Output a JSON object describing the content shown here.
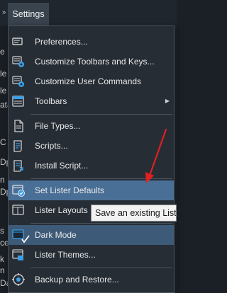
{
  "menubar": {
    "chevron": "»",
    "settings_label": "Settings"
  },
  "background_letters": [
    "e",
    "le",
    "le",
    "ata",
    "C",
    "Dp",
    "n",
    "Dp",
    "s",
    "cen",
    "k",
    "n",
    "Da"
  ],
  "menu": {
    "items": [
      {
        "label": "Preferences...",
        "icon": "preferences-icon"
      },
      {
        "label": "Customize Toolbars and Keys...",
        "icon": "customize-toolbars-icon"
      },
      {
        "label": "Customize User Commands",
        "icon": "user-commands-icon"
      },
      {
        "label": "Toolbars",
        "icon": "toolbars-icon",
        "submenu_arrow": "▶"
      },
      {
        "label": "File Types...",
        "icon": "file-types-icon"
      },
      {
        "label": "Scripts...",
        "icon": "scripts-icon"
      },
      {
        "label": "Install Script...",
        "icon": "install-script-icon"
      },
      {
        "label": "Set Lister Defaults",
        "icon": "lister-defaults-icon",
        "highlighted": true
      },
      {
        "label": "Lister Layouts",
        "icon": "lister-layouts-icon"
      },
      {
        "label": "Dark Mode",
        "icon": "dark-mode-icon",
        "checked": true
      },
      {
        "label": "Lister Themes...",
        "icon": "lister-themes-icon"
      },
      {
        "label": "Backup and Restore...",
        "icon": "backup-restore-icon"
      }
    ]
  },
  "tooltip": {
    "text": "Save an existing Lister"
  },
  "colors": {
    "highlight": "#4a6f96",
    "menu_bg": "#262d35",
    "annotation_arrow": "#e02020",
    "icon_blue": "#3aa0e8"
  }
}
